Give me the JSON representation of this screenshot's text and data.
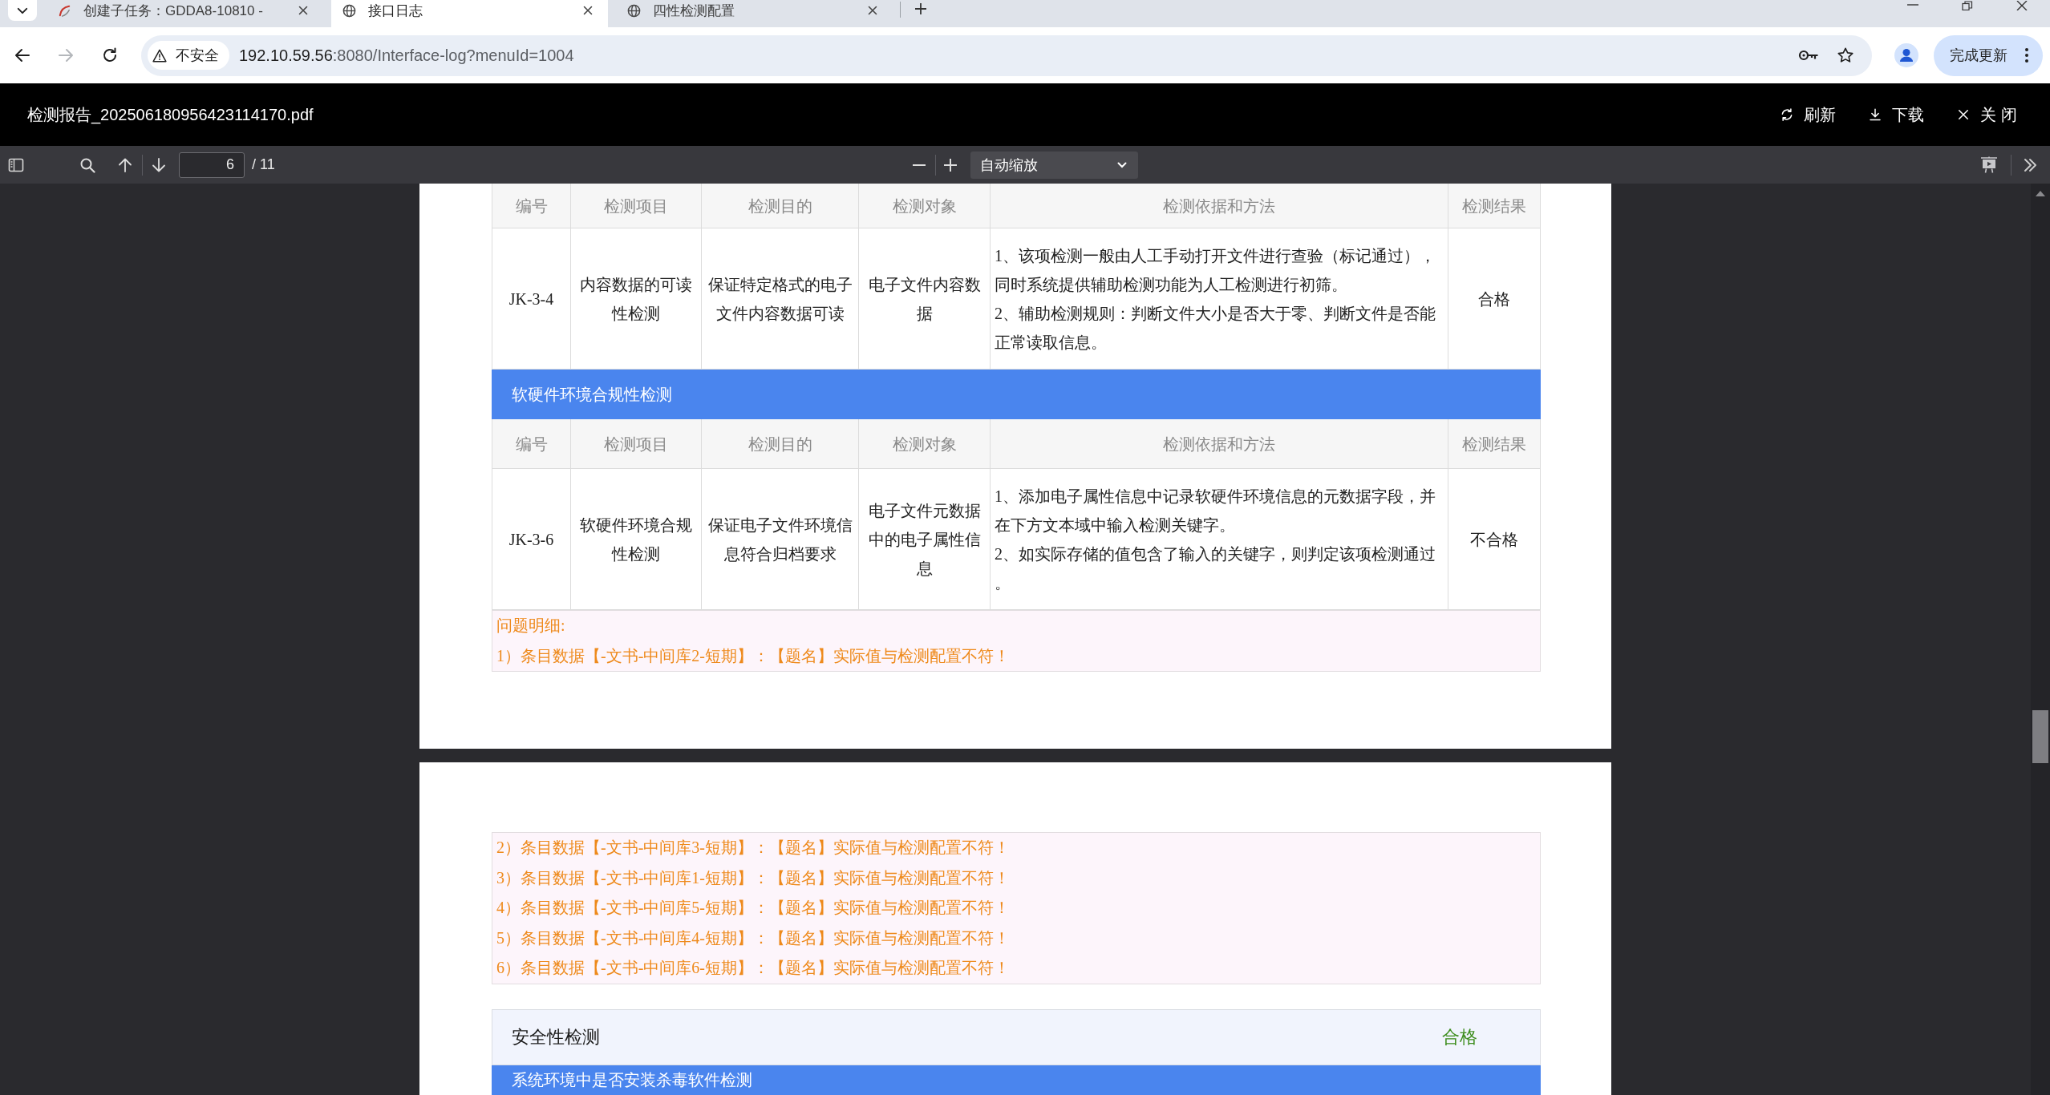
{
  "browser": {
    "tabs": [
      {
        "kind": "logo",
        "title": "创建子任务：GDDA8-10810 -",
        "selected": false
      },
      {
        "kind": "globe",
        "title": "接口日志",
        "selected": true
      },
      {
        "kind": "globe",
        "title": "四性检测配置",
        "selected": false
      }
    ],
    "back_disabled": false,
    "forward_disabled": true,
    "security_chip": "不安全",
    "url_host": "192.10.59.56",
    "url_path": ":8080/Interface-log?menuId=1004",
    "update_button": "完成更新"
  },
  "pdf_header": {
    "filename": "检测报告_202506180956423114170.pdf",
    "actions": [
      {
        "kind": "refresh",
        "label": "刷新"
      },
      {
        "kind": "download",
        "label": "下载"
      },
      {
        "kind": "close",
        "label": "关 闭"
      }
    ]
  },
  "pdf_toolbar": {
    "page_number": "6",
    "page_count": "/ 11",
    "zoom": "自动缩放"
  },
  "pages": [
    {
      "blocks": [
        {
          "kind": "header",
          "cells": [
            "编号",
            "检测项目",
            "检测目的",
            "检测对象",
            "检测依据和方法",
            "检测结果"
          ]
        },
        {
          "kind": "row",
          "cells": [
            "JK-3-4",
            "内容数据的可读性检测",
            "保证特定格式的电子文件内容数据可读",
            "电子文件内容数据"
          ],
          "method": [
            "1、该项检测一般由人工手动打开文件进行查验（标记通过），同时系统提供辅助检测功能为人工检测进行初筛。",
            "2、辅助检测规则：判断文件大小是否大于零、判断文件是否能正常读取信息。"
          ],
          "result": "合格"
        },
        {
          "kind": "section",
          "title": "软硬件环境合规性检测"
        },
        {
          "kind": "header",
          "cells": [
            "编号",
            "检测项目",
            "检测目的",
            "检测对象",
            "检测依据和方法",
            "检测结果"
          ]
        },
        {
          "kind": "row",
          "cells": [
            "JK-3-6",
            "软硬件环境合规性检测",
            "保证电子文件环境信息符合归档要求",
            "电子文件元数据中的电子属性信息"
          ],
          "method": [
            "1、添加电子属性信息中记录软硬件环境信息的元数据字段，并在下方文本域中输入检测关键字。",
            "2、如实际存储的值包含了输入的关键字，则判定该项检测通过。"
          ],
          "result": "不合格"
        },
        {
          "kind": "problems",
          "title": "问题明细:",
          "items": [
            "1）条目数据【-文书-中间库2-短期】：【题名】实际值与检测配置不符！"
          ]
        }
      ]
    },
    {
      "blocks": [
        {
          "kind": "problems",
          "items": [
            "2）条目数据【-文书-中间库3-短期】：【题名】实际值与检测配置不符！",
            "3）条目数据【-文书-中间库1-短期】：【题名】实际值与检测配置不符！",
            "4）条目数据【-文书-中间库5-短期】：【题名】实际值与检测配置不符！",
            "5）条目数据【-文书-中间库4-短期】：【题名】实际值与检测配置不符！",
            "6）条目数据【-文书-中间库6-短期】：【题名】实际值与检测配置不符！"
          ]
        },
        {
          "kind": "category",
          "title": "安全性检测",
          "result": "合格"
        },
        {
          "kind": "section",
          "title": "系统环境中是否安装杀毒软件检测"
        }
      ]
    }
  ]
}
